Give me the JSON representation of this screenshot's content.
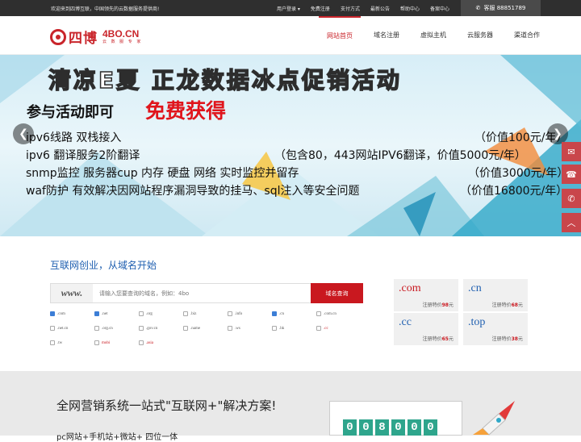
{
  "topbar": {
    "welcome": "欢迎来到四博互联，中国领先的云数据服务提供商!",
    "links": [
      "用户登录 ▾",
      "免费注册",
      "支付方式",
      "最新公告",
      "帮助中心",
      "备案中心"
    ],
    "hotline": "客服 88851789"
  },
  "logo": {
    "cn": "四博",
    "en": "4BO.CN",
    "slogan": "云 数 服 专 家"
  },
  "nav": [
    "网站首页",
    "域名注册",
    "虚拟主机",
    "云服务器",
    "渠道合作"
  ],
  "banner": {
    "title": "清凉E夏  正龙数据冰点促销活动",
    "sub": "参与活动即可",
    "free": "免费获得",
    "lines": [
      {
        "text": "ipv6线路   双栈接入",
        "value": "（价值100元/年）"
      },
      {
        "text": "ipv6 翻译服务2阶翻译",
        "value": "（包含80，443网站IPV6翻译，价值5000元/年）"
      },
      {
        "text": "snmp监控  服务器cup 内存 硬盘 网络 实时监控并留存",
        "value": "（价值3000元/年）"
      },
      {
        "text": "waf防护  有效解决因网站程序漏洞导致的挂马、sql注入等安全问题",
        "value": "（价值16800元/年）"
      }
    ],
    "prev": "❮",
    "next": "❯"
  },
  "side": [
    "✉",
    "☎",
    "✆",
    "︿"
  ],
  "domain": {
    "title": "互联网创业，从域名开始",
    "prefix": "www.",
    "placeholder": "请输入您要查询的域名，例如：4bo",
    "button": "域名查询",
    "exts": [
      {
        "name": ".com",
        "checked": true
      },
      {
        "name": ".net",
        "checked": true
      },
      {
        "name": ".org",
        "checked": false
      },
      {
        "name": ".biz",
        "checked": false
      },
      {
        "name": ".info",
        "checked": false
      },
      {
        "name": ".cn",
        "checked": true
      },
      {
        "name": ".com.cn",
        "checked": false
      },
      {
        "name": ".net.cn",
        "checked": false
      },
      {
        "name": ".org.cn",
        "checked": false
      },
      {
        "name": ".gov.cn",
        "checked": false
      },
      {
        "name": ".name",
        "checked": false
      },
      {
        "name": ".ws",
        "checked": false
      },
      {
        "name": ".hk",
        "checked": false
      },
      {
        "name": ".cc",
        "checked": false,
        "red": true
      },
      {
        "name": ".tw",
        "checked": false
      },
      {
        "name": "mobi",
        "checked": false,
        "red": true
      },
      {
        "name": ".asia",
        "checked": false,
        "red": true
      }
    ]
  },
  "prices": [
    {
      "tld": ".com",
      "color": "#c9181f",
      "label": "注册特价",
      "price": "98",
      "unit": "元"
    },
    {
      "tld": ".cn",
      "color": "#1f5fb0",
      "label": "注册特价",
      "price": "68",
      "unit": "元"
    },
    {
      "tld": ".cc",
      "color": "#1f5fb0",
      "label": "注册特价",
      "price": "65",
      "unit": "元"
    },
    {
      "tld": ".top",
      "color": "#1f5fb0",
      "label": "注册特价",
      "price": "38",
      "unit": "元"
    }
  ],
  "promo": {
    "title": "全网营销系统一站式\"互联网+\"解决方案!",
    "sub": "pc网站+手机站+微站+    四位一体",
    "digits": [
      "0",
      "0",
      "8",
      "0",
      "0",
      "0"
    ]
  },
  "colors": {
    "brand": "#c9252b",
    "link": "#1f5fb0",
    "topbar": "#2f2f2f"
  }
}
